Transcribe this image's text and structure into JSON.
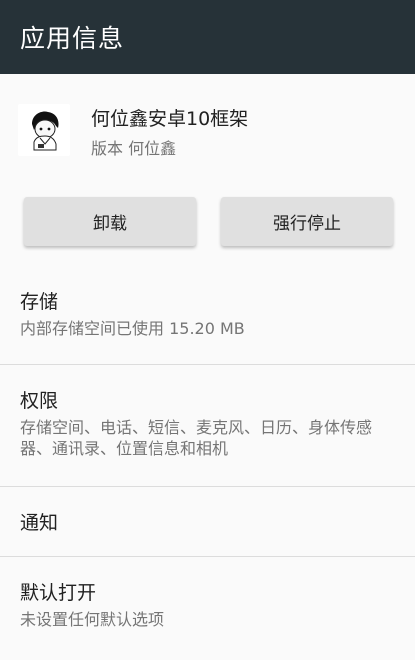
{
  "toolbar": {
    "title": "应用信息"
  },
  "app": {
    "name": "何位鑫安卓10框架",
    "version": "版本 何位鑫"
  },
  "buttons": {
    "uninstall": "卸载",
    "force_stop": "强行停止"
  },
  "sections": {
    "storage": {
      "title": "存储",
      "summary": "内部存储空间已使用 15.20 MB"
    },
    "permissions": {
      "title": "权限",
      "summary": "存储空间、电话、短信、麦克风、日历、身体传感器、通讯录、位置信息和相机"
    },
    "notifications": {
      "title": "通知"
    },
    "open_by_default": {
      "title": "默认打开",
      "summary": "未设置任何默认选项"
    }
  }
}
